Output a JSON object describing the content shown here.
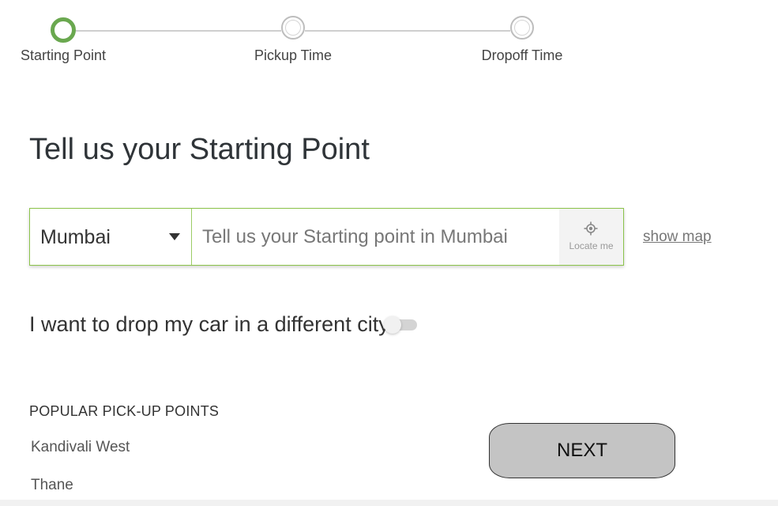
{
  "stepper": {
    "steps": [
      {
        "label": "Starting Point",
        "state": "active"
      },
      {
        "label": "Pickup Time",
        "state": "inactive"
      },
      {
        "label": "Dropoff Time",
        "state": "inactive"
      }
    ],
    "active_color": "#6aa84f"
  },
  "heading": "Tell us your Starting Point",
  "search": {
    "city": "Mumbai",
    "placeholder": "Tell us your Starting point in Mumbai",
    "locate_label": "Locate me"
  },
  "show_map": "show map",
  "toggle": {
    "label": "I want to drop my car in a different city",
    "on": false
  },
  "popular": {
    "title": "POPULAR PICK-UP POINTS",
    "items": [
      "Kandivali West",
      "Thane"
    ]
  },
  "next_label": "NEXT"
}
